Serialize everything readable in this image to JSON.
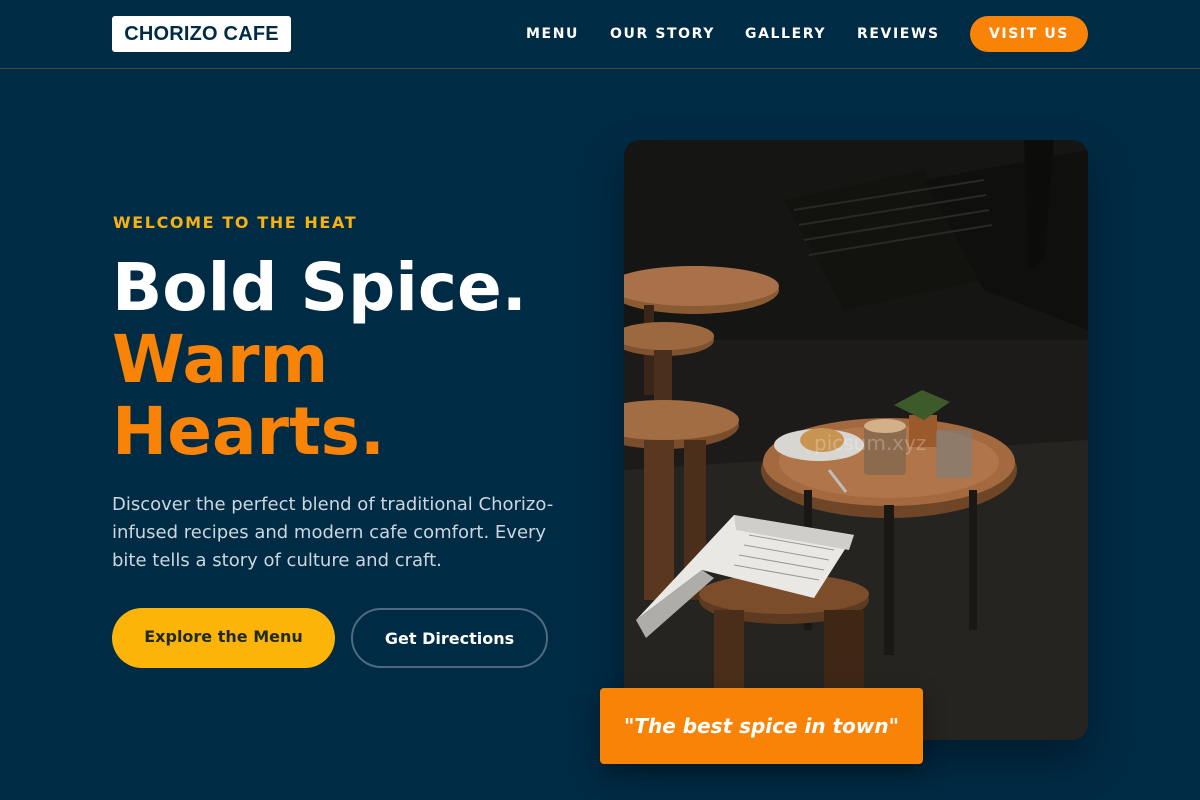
{
  "header": {
    "logo": "CHORIZO CAFE",
    "nav": [
      "MENU",
      "OUR STORY",
      "GALLERY",
      "REVIEWS"
    ],
    "cta": "VISIT US"
  },
  "hero": {
    "eyebrow": "WELCOME TO THE HEAT",
    "title_line1": "Bold Spice.",
    "title_line2": "Warm",
    "title_line3": "Hearts.",
    "description": "Discover the perfect blend of traditional Chorizo-infused recipes and modern cafe comfort. Every bite tells a story of culture and craft.",
    "primary_button": "Explore the Menu",
    "secondary_button": "Get Directions"
  },
  "image": {
    "alt": "Cafe table with coffee, croissant and open magazine",
    "watermark": "picsum.xyz"
  },
  "quote": "\"The best spice in town\"",
  "colors": {
    "background": "#002b45",
    "accent_orange": "#f98306",
    "accent_yellow": "#fbb407",
    "eyebrow": "#f7b212",
    "text_white": "#ffffff"
  }
}
